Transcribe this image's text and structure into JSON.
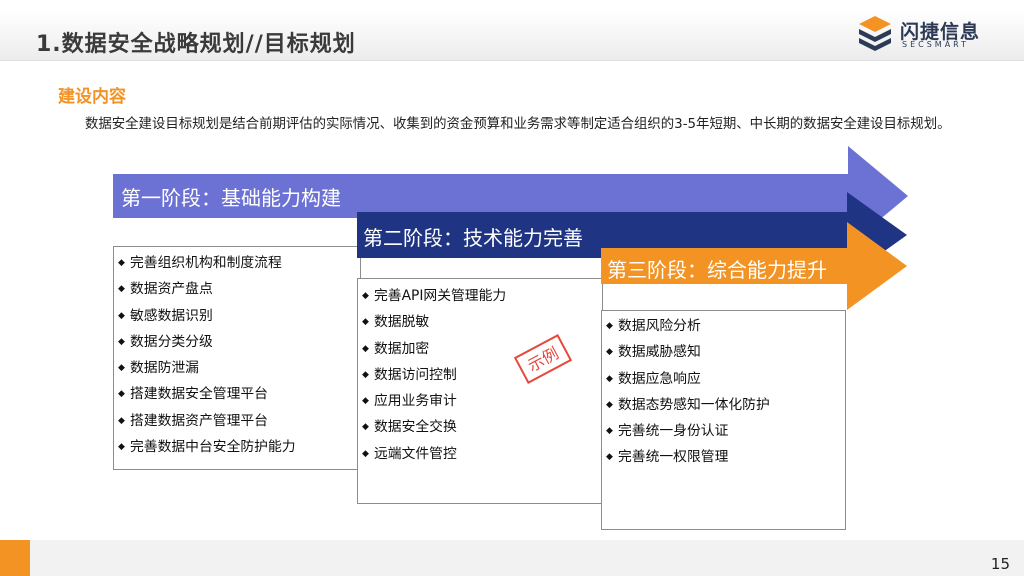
{
  "header": {
    "title": "1.数据安全战略规划//目标规划",
    "logo_text": "闪捷信息",
    "logo_sub": "SECSMART"
  },
  "section_heading": "建设内容",
  "intro_text": "数据安全建设目标规划是结合前期评估的实际情况、收集到的资金预算和业务需求等制定适合组织的3-5年短期、中长期的数据安全建设目标规划。",
  "stages": [
    {
      "label": "第一阶段：基础能力构建",
      "color": "#6c72d4",
      "items": [
        "完善组织机构和制度流程",
        "数据资产盘点",
        "敏感数据识别",
        "数据分类分级",
        "数据防泄漏",
        "搭建数据安全管理平台",
        "搭建数据资产管理平台",
        "完善数据中台安全防护能力"
      ]
    },
    {
      "label": "第二阶段：技术能力完善",
      "color": "#1f3584",
      "items": [
        "完善API网关管理能力",
        "数据脱敏",
        "数据加密",
        "数据访问控制",
        "应用业务审计",
        "数据安全交换",
        "远端文件管控"
      ]
    },
    {
      "label": "第三阶段：综合能力提升",
      "color": "#f39323",
      "items": [
        "数据风险分析",
        "数据威胁感知",
        "数据应急响应",
        "数据态势感知一体化防护",
        "完善统一身份认证",
        "完善统一权限管理"
      ]
    }
  ],
  "bullet_symbol": "◆",
  "stamp_text": "示例",
  "page_number": "15",
  "colors": {
    "accent": "#f39323",
    "stamp": "#e8483c"
  }
}
